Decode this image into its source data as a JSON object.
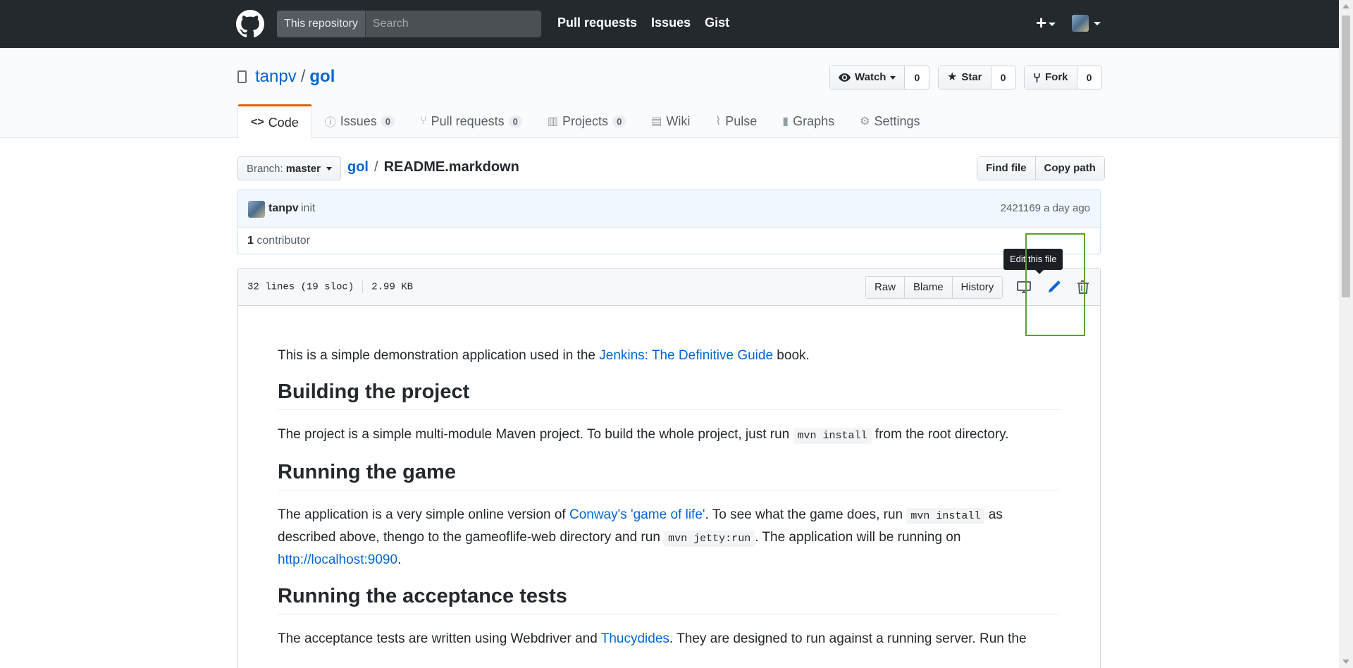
{
  "header": {
    "search_scope": "This repository",
    "search_placeholder": "Search",
    "nav": [
      "Pull requests",
      "Issues",
      "Gist"
    ],
    "plus_label": "+"
  },
  "repo": {
    "owner": "tanpv",
    "separator": "/",
    "name": "gol",
    "watch": {
      "label": "Watch",
      "count": "0"
    },
    "star": {
      "label": "Star",
      "count": "0"
    },
    "fork": {
      "label": "Fork",
      "count": "0"
    },
    "tabs": [
      {
        "label": "Code"
      },
      {
        "label": "Issues",
        "count": "0"
      },
      {
        "label": "Pull requests",
        "count": "0"
      },
      {
        "label": "Projects",
        "count": "0"
      },
      {
        "label": "Wiki"
      },
      {
        "label": "Pulse"
      },
      {
        "label": "Graphs"
      },
      {
        "label": "Settings"
      }
    ]
  },
  "filenav": {
    "branch_label": "Branch:",
    "branch_value": "master",
    "path_root": "gol",
    "path_sep": "/",
    "file_name": "README.markdown",
    "find_file": "Find file",
    "copy_path": "Copy path"
  },
  "commit": {
    "author": "tanpv",
    "message": "init",
    "sha": "2421169",
    "time": "a day ago",
    "contributors_count": "1",
    "contributors_label": "contributor"
  },
  "file": {
    "lines": "32 lines (19 sloc)",
    "size": "2.99 KB",
    "raw": "Raw",
    "blame": "Blame",
    "history": "History",
    "tooltip": "Edit this file"
  },
  "readme": {
    "p1_pre": "This is a simple demonstration application used in the ",
    "p1_link": "Jenkins: The Definitive Guide",
    "p1_post": " book.",
    "h_build": "Building the project",
    "p2_pre": "The project is a simple multi-module Maven project. To build the whole project, just run ",
    "p2_code": "mvn install",
    "p2_post": " from the root directory.",
    "h_run": "Running the game",
    "p3_a": "The application is a very simple online version of ",
    "p3_link": "Conway's 'game of life'",
    "p3_b": ". To see what the game does, run ",
    "p3_code1": "mvn install",
    "p3_c": " as described above, thengo to the gameoflife-web directory and run ",
    "p3_code2": "mvn jetty:run",
    "p3_d": ". The application will be running on ",
    "p3_url": "http://localhost:9090",
    "p3_e": ".",
    "h_accept": "Running the acceptance tests",
    "p4_pre": "The acceptance tests are written using Webdriver and ",
    "p4_link": "Thucydides",
    "p4_post": ". They are designed to run against a running server. Run the"
  }
}
